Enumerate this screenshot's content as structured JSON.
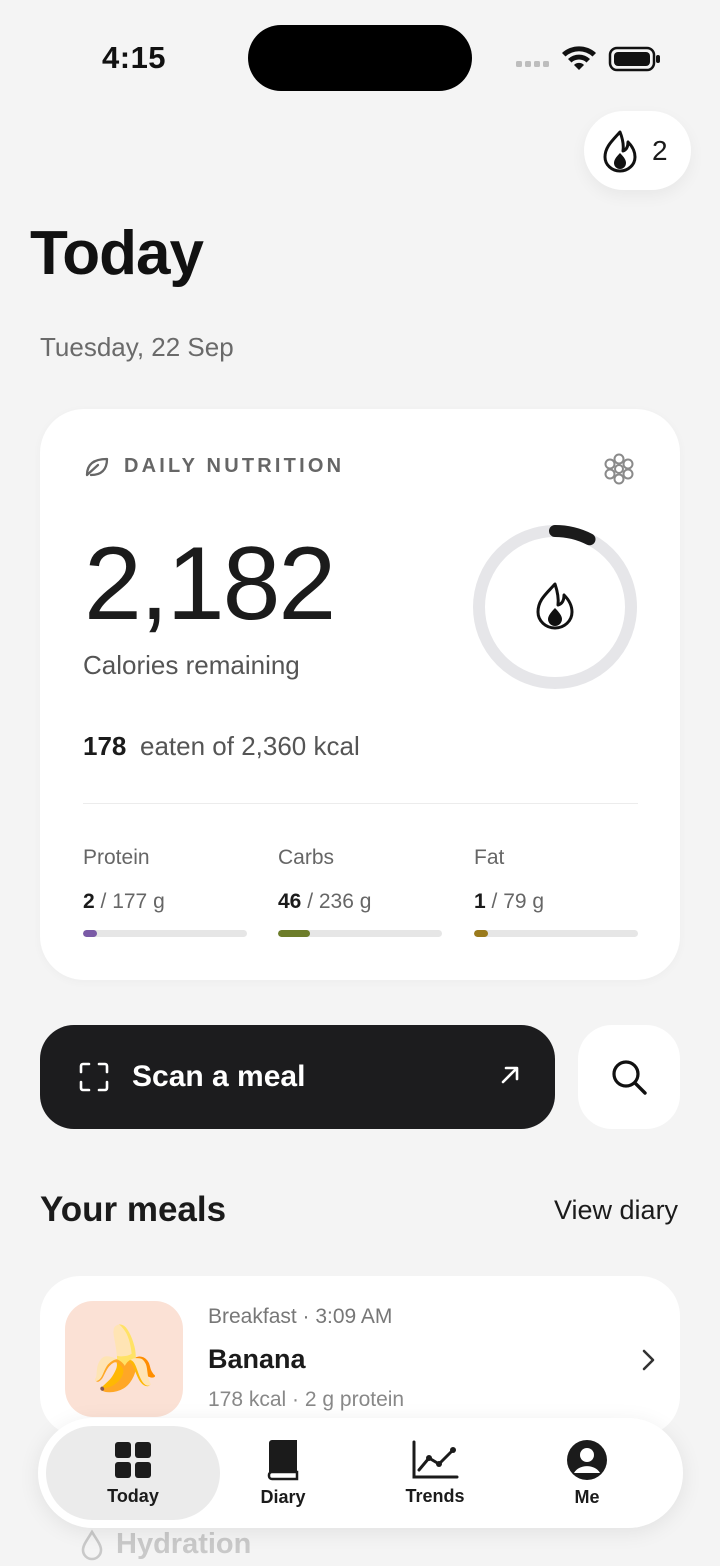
{
  "status_bar": {
    "time": "4:15"
  },
  "streak": {
    "count": "2",
    "icon": "flame-icon"
  },
  "header": {
    "title": "Today",
    "date": "Tuesday, 22 Sep"
  },
  "nutrition": {
    "heading": "DAILY NUTRITION",
    "calories_remaining": "2,182",
    "calories_label": "Calories remaining",
    "eaten": "178",
    "eaten_of": "eaten of 2,360 kcal",
    "progress_fraction": 0.075,
    "macros": [
      {
        "name": "Protein",
        "current": "2",
        "target": "/ 177 g",
        "fraction": 0.011,
        "color": "#7a5aa6"
      },
      {
        "name": "Carbs",
        "current": "46",
        "target": "/ 236 g",
        "fraction": 0.195,
        "color": "#6d7d2a"
      },
      {
        "name": "Fat",
        "current": "1",
        "target": "/ 79 g",
        "fraction": 0.013,
        "color": "#9a7a1c"
      }
    ]
  },
  "actions": {
    "scan_label": "Scan a meal"
  },
  "meals_section": {
    "title": "Your meals",
    "link": "View diary"
  },
  "meals": [
    {
      "meta": "Breakfast · 3:09 AM",
      "name": "Banana",
      "sub": "178 kcal · 2 g protein",
      "emoji": "🍌"
    }
  ],
  "hydration": {
    "label": "Hydration"
  },
  "tabs": [
    {
      "label": "Today",
      "icon": "grid-icon",
      "active": true
    },
    {
      "label": "Diary",
      "icon": "book-icon",
      "active": false
    },
    {
      "label": "Trends",
      "icon": "chart-icon",
      "active": false
    },
    {
      "label": "Me",
      "icon": "profile-icon",
      "active": false
    }
  ],
  "colors": {
    "background": "#f4f4f4",
    "card": "#ffffff",
    "button_dark": "#1c1c1e"
  }
}
